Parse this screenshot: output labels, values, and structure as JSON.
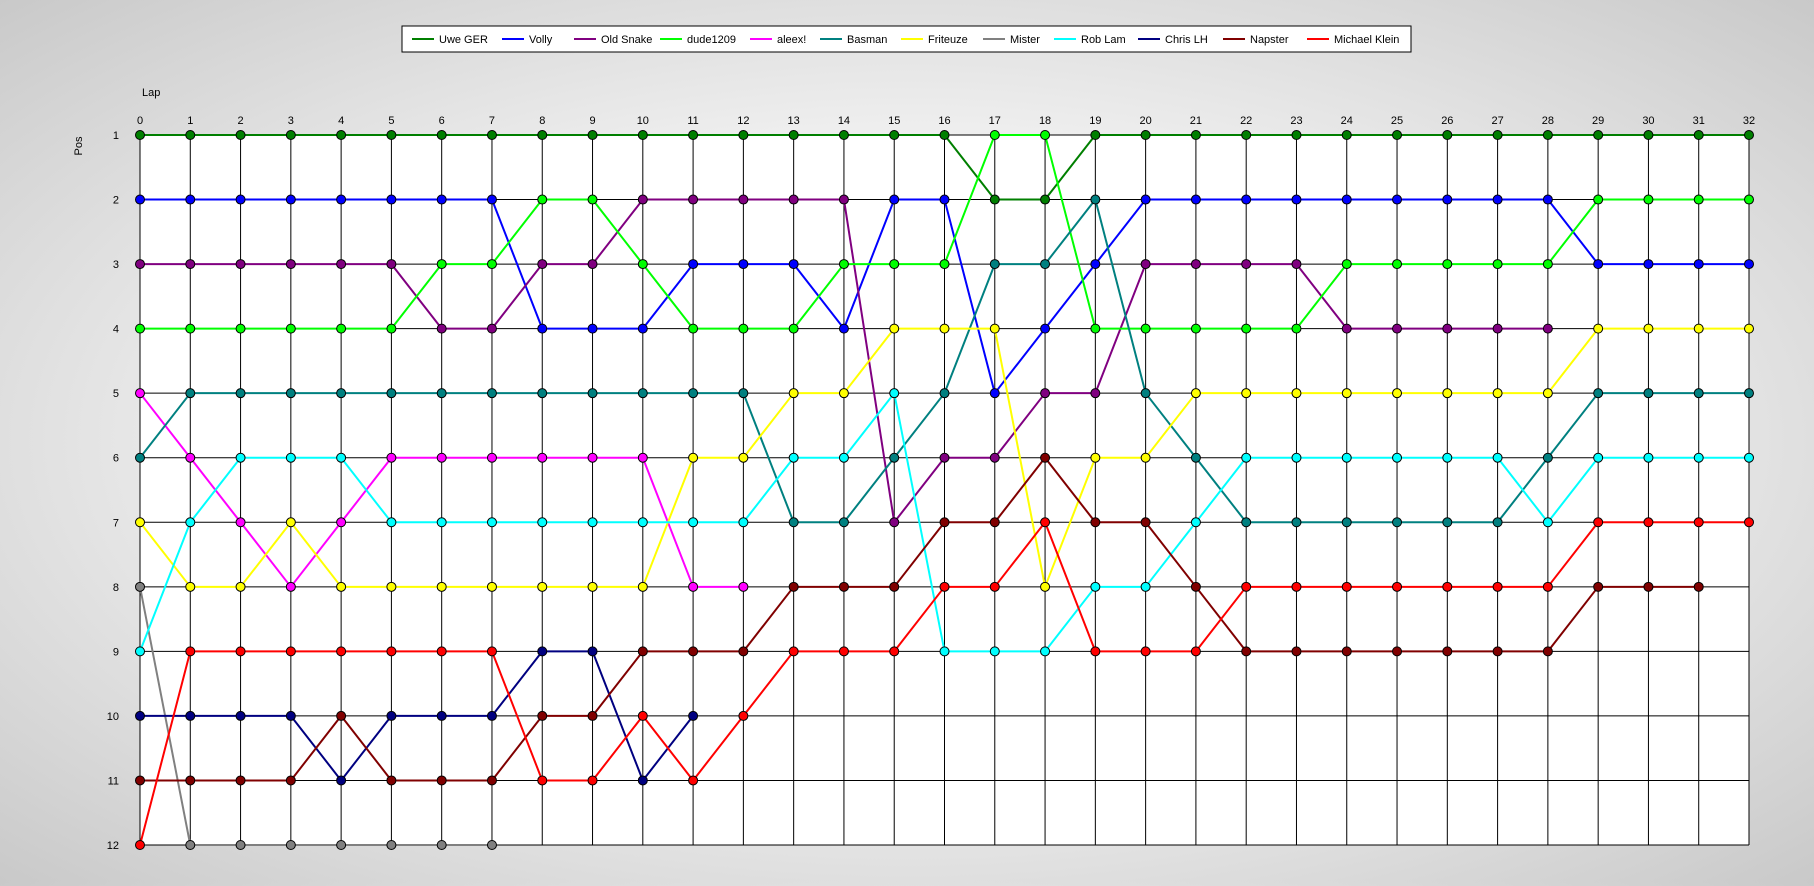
{
  "chart_data": {
    "type": "line",
    "xlabel": "Lap",
    "ylabel": "Pos",
    "x": [
      0,
      1,
      2,
      3,
      4,
      5,
      6,
      7,
      8,
      9,
      10,
      11,
      12,
      13,
      14,
      15,
      16,
      17,
      18,
      19,
      20,
      21,
      22,
      23,
      24,
      25,
      26,
      27,
      28,
      29,
      30,
      31,
      32
    ],
    "y_ticks": [
      1,
      2,
      3,
      4,
      5,
      6,
      7,
      8,
      9,
      10,
      11,
      12
    ],
    "xlim": [
      0,
      32
    ],
    "ylim": [
      1,
      12
    ],
    "y_inverted": true,
    "grid": true,
    "legend_position": "top",
    "series": [
      {
        "name": "Uwe GER",
        "color": "#007f00",
        "values": [
          1,
          1,
          1,
          1,
          1,
          1,
          1,
          1,
          1,
          1,
          1,
          1,
          1,
          1,
          1,
          1,
          1,
          2,
          2,
          1,
          1,
          1,
          1,
          1,
          1,
          1,
          1,
          1,
          1,
          1,
          1,
          1,
          1
        ]
      },
      {
        "name": "Volly",
        "color": "#0000ff",
        "values": [
          2,
          2,
          2,
          2,
          2,
          2,
          2,
          2,
          4,
          4,
          4,
          3,
          3,
          3,
          4,
          2,
          2,
          5,
          4,
          3,
          2,
          2,
          2,
          2,
          2,
          2,
          2,
          2,
          2,
          3,
          3,
          3,
          3
        ]
      },
      {
        "name": "Old Snake",
        "color": "#800080",
        "values": [
          3,
          3,
          3,
          3,
          3,
          3,
          4,
          4,
          3,
          3,
          2,
          2,
          2,
          2,
          2,
          7,
          6,
          6,
          5,
          5,
          3,
          3,
          3,
          3,
          4,
          4,
          4,
          4,
          4,
          null,
          null,
          null,
          null
        ]
      },
      {
        "name": "dude1209",
        "color": "#00ff00",
        "values": [
          4,
          4,
          4,
          4,
          4,
          4,
          3,
          3,
          2,
          2,
          3,
          4,
          4,
          4,
          3,
          3,
          3,
          1,
          1,
          4,
          4,
          4,
          4,
          4,
          3,
          3,
          3,
          3,
          3,
          2,
          2,
          2,
          2
        ]
      },
      {
        "name": "aleex!",
        "color": "#ff00ff",
        "values": [
          5,
          6,
          7,
          8,
          7,
          6,
          6,
          6,
          6,
          6,
          6,
          8,
          8,
          null,
          null,
          null,
          null,
          null,
          null,
          null,
          null,
          null,
          null,
          null,
          null,
          null,
          null,
          null,
          null,
          null,
          null,
          null,
          null
        ]
      },
      {
        "name": "Basman",
        "color": "#008080",
        "values": [
          6,
          5,
          5,
          5,
          5,
          5,
          5,
          5,
          5,
          5,
          5,
          5,
          5,
          7,
          7,
          6,
          5,
          3,
          3,
          2,
          5,
          6,
          7,
          7,
          7,
          7,
          7,
          7,
          6,
          5,
          5,
          5,
          5
        ]
      },
      {
        "name": "Friteuze",
        "color": "#ffff00",
        "values": [
          7,
          8,
          8,
          7,
          8,
          8,
          8,
          8,
          8,
          8,
          8,
          6,
          6,
          5,
          5,
          4,
          4,
          4,
          8,
          6,
          6,
          5,
          5,
          5,
          5,
          5,
          5,
          5,
          5,
          4,
          4,
          4,
          4
        ]
      },
      {
        "name": "Mister",
        "color": "#808080",
        "values": [
          8,
          12,
          12,
          12,
          12,
          12,
          12,
          12,
          null,
          null,
          null,
          null,
          null,
          null,
          null,
          null,
          null,
          null,
          null,
          null,
          null,
          null,
          null,
          null,
          null,
          null,
          null,
          null,
          null,
          null,
          null,
          null,
          null
        ]
      },
      {
        "name": "Rob Lam",
        "color": "#00ffff",
        "values": [
          9,
          7,
          6,
          6,
          6,
          7,
          7,
          7,
          7,
          7,
          7,
          7,
          7,
          6,
          6,
          5,
          9,
          9,
          9,
          8,
          8,
          7,
          6,
          6,
          6,
          6,
          6,
          6,
          7,
          6,
          6,
          6,
          6
        ]
      },
      {
        "name": "Chris LH",
        "color": "#000080",
        "values": [
          10,
          10,
          10,
          10,
          11,
          10,
          10,
          10,
          9,
          9,
          11,
          10,
          null,
          null,
          null,
          null,
          null,
          null,
          null,
          null,
          null,
          null,
          null,
          null,
          null,
          null,
          null,
          null,
          null,
          null,
          null,
          null,
          null
        ]
      },
      {
        "name": "Napster",
        "color": "#800000",
        "values": [
          11,
          11,
          11,
          11,
          10,
          11,
          11,
          11,
          10,
          10,
          9,
          9,
          9,
          8,
          8,
          8,
          7,
          7,
          6,
          7,
          7,
          8,
          9,
          9,
          9,
          9,
          9,
          9,
          9,
          8,
          8,
          8,
          null
        ]
      },
      {
        "name": "Michael Klein",
        "color": "#ff0000",
        "values": [
          12,
          9,
          9,
          9,
          9,
          9,
          9,
          9,
          11,
          11,
          10,
          11,
          10,
          9,
          9,
          9,
          8,
          8,
          7,
          9,
          9,
          9,
          8,
          8,
          8,
          8,
          8,
          8,
          8,
          7,
          7,
          7,
          7
        ]
      }
    ]
  }
}
